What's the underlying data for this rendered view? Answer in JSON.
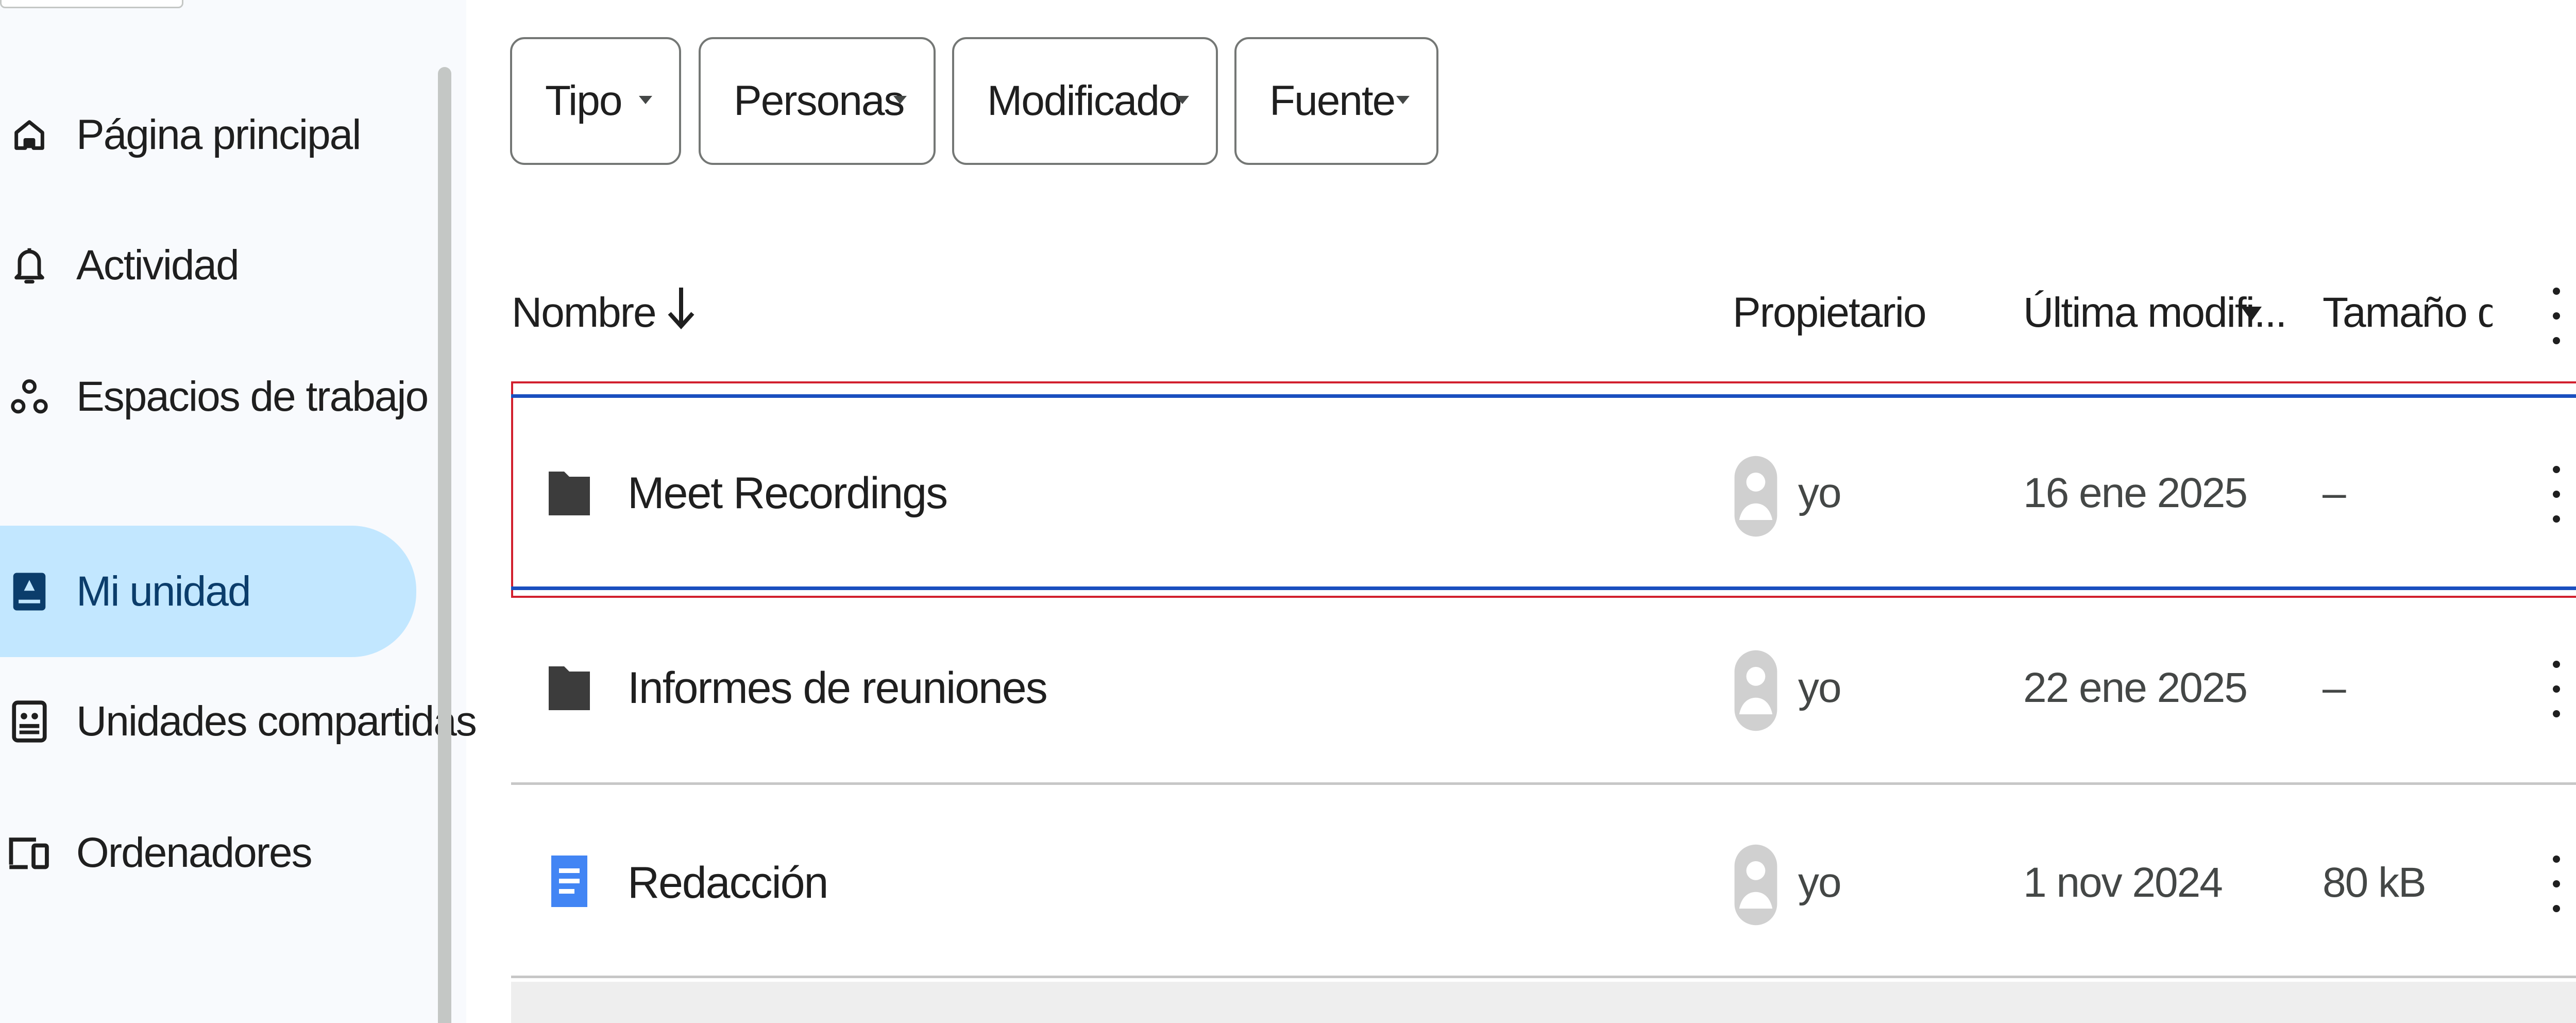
{
  "sidebar": {
    "items": [
      {
        "label": "Página principal",
        "icon": "home-icon",
        "active": false
      },
      {
        "label": "Actividad",
        "icon": "bell-icon",
        "active": false
      },
      {
        "label": "Espacios de trabajo",
        "icon": "workspaces-icon",
        "active": false
      },
      {
        "label": "Mi unidad",
        "icon": "my-drive-icon",
        "active": true
      },
      {
        "label": "Unidades compartidas",
        "icon": "shared-drives-icon",
        "active": false
      },
      {
        "label": "Ordenadores",
        "icon": "computers-icon",
        "active": false
      }
    ]
  },
  "filters": {
    "chips": [
      {
        "label": "Tipo"
      },
      {
        "label": "Personas"
      },
      {
        "label": "Modificado"
      },
      {
        "label": "Fuente"
      }
    ]
  },
  "table": {
    "headers": {
      "name": "Nombre",
      "owner": "Propietario",
      "modified": "Última modifi...",
      "size": "Tamaño de a"
    },
    "rows": [
      {
        "name": "Meet Recordings",
        "type_icon": "folder-icon",
        "owner": "yo",
        "modified": "16 ene 2025",
        "size": "–",
        "selected": true
      },
      {
        "name": "Informes de reuniones",
        "type_icon": "folder-icon",
        "owner": "yo",
        "modified": "22 ene 2025",
        "size": "–",
        "selected": false
      },
      {
        "name": "Redacción",
        "type_icon": "google-docs-icon",
        "owner": "yo",
        "modified": "1 nov 2024",
        "size": "80 kB",
        "selected": false
      }
    ]
  },
  "colors": {
    "sidebar_bg": "#f8fafd",
    "active_nav_bg": "#c2e7ff",
    "selection_blue": "#1a4fbf",
    "selection_red_outline": "#d2202e",
    "docs_blue": "#4285f4"
  }
}
